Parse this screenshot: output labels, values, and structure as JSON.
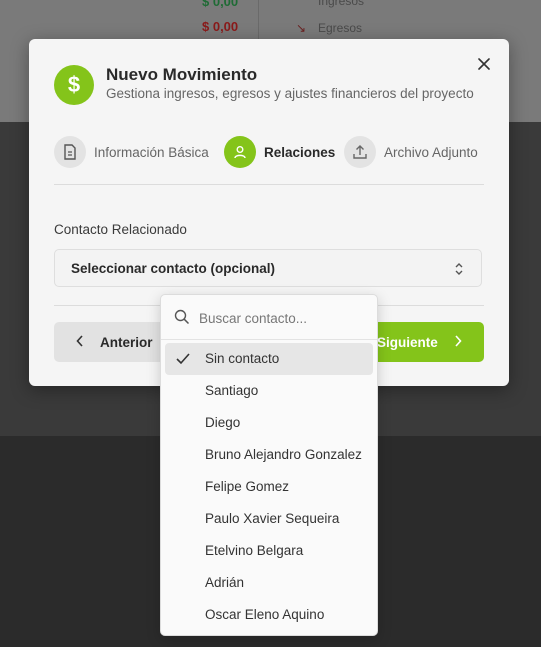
{
  "background": {
    "value_green": "$ 0,00",
    "value_red": "$ 0,00",
    "legend_income": "Ingresos",
    "legend_expense": "Egresos"
  },
  "colors": {
    "accent": "#84c41a",
    "income": "#2e9e4f",
    "expense": "#c62828"
  },
  "modal": {
    "title": "Nuevo Movimiento",
    "subtitle": "Gestiona ingresos, egresos y ajustes financieros del proyecto",
    "header_icon": "dollar-icon",
    "close_icon": "close-icon",
    "steps": [
      {
        "label": "Información Básica",
        "icon": "document-icon",
        "active": false
      },
      {
        "label": "Relaciones",
        "icon": "user-icon",
        "active": true
      },
      {
        "label": "Archivo Adjunto",
        "icon": "upload-icon",
        "active": false
      }
    ],
    "field_label": "Contacto Relacionado",
    "select_value": "Seleccionar contacto (opcional)",
    "prev_label": "Anterior",
    "next_label": "Siguiente"
  },
  "dropdown": {
    "search_placeholder": "Buscar contacto...",
    "selected_index": 0,
    "options": [
      "Sin contacto",
      "Santiago",
      "Diego",
      "Bruno Alejandro Gonzalez",
      "Felipe Gomez",
      "Paulo Xavier Sequeira",
      "Etelvino Belgara",
      "Adrián",
      "Oscar Eleno Aquino"
    ]
  }
}
